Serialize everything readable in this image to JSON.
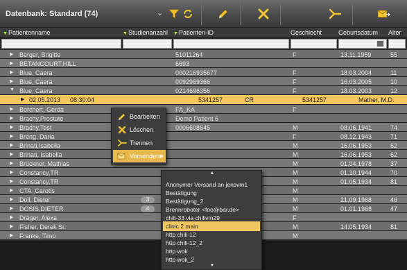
{
  "toolbar": {
    "title": "Datenbank: Standard (74)",
    "caret": "⌄",
    "icons": [
      "filter-icon",
      "refresh-icon",
      "edit-icon",
      "delete-icon",
      "split-icon",
      "send-icon"
    ]
  },
  "columns": [
    {
      "label": "Patientenname",
      "filter": true
    },
    {
      "label": "Studienanzahl",
      "filter": true
    },
    {
      "label": "Patienten-ID",
      "filter": true
    },
    {
      "label": "Geschlecht",
      "filter": false
    },
    {
      "label": "Geburtsdatum",
      "filter": false
    },
    {
      "label": "Alter",
      "filter": false
    }
  ],
  "rows": [
    {
      "name": "Berger, Brigitte",
      "count": "",
      "id": "51011264",
      "sex": "F",
      "dob": "13.11.1959",
      "age": "55",
      "exp": "▶"
    },
    {
      "name": "BETANCOURT,HILL",
      "count": "",
      "id": "6693",
      "sex": "",
      "dob": "",
      "age": "",
      "exp": "▶"
    },
    {
      "name": "Blue, Caera",
      "count": "",
      "id": "000216935677",
      "sex": "F",
      "dob": "18.03.2004",
      "age": "11",
      "exp": "▶"
    },
    {
      "name": "Blue, Caera",
      "count": "",
      "id": "0092969366",
      "sex": "F",
      "dob": "16.03.2005",
      "age": "10",
      "exp": "▶"
    },
    {
      "name": "Blue, Caera",
      "count": "",
      "id": "0214696356",
      "sex": "F",
      "dob": "18.03.2003",
      "age": "12",
      "exp": "▼"
    },
    {
      "name": "Borchert, Gerda",
      "count": "",
      "id": "FA_KA",
      "sex": "F",
      "dob": "",
      "age": "",
      "exp": "▶"
    },
    {
      "name": "Brachy,Prostate",
      "count": "",
      "id": "Demo Patient 6",
      "sex": "",
      "dob": "",
      "age": "",
      "exp": "▶"
    },
    {
      "name": "Brachy,Test",
      "count": "",
      "id": "0006608645",
      "sex": "M",
      "dob": "08.06.1941",
      "age": "74",
      "exp": "▶"
    },
    {
      "name": "Breng, Daria",
      "count": "",
      "id": "",
      "sex": "F",
      "dob": "08.12.1943",
      "age": "71",
      "exp": "▶"
    },
    {
      "name": "Brinati,Isabella",
      "count": "",
      "id": "",
      "sex": "M",
      "dob": "16.06.1953",
      "age": "62",
      "exp": "▶"
    },
    {
      "name": "Brinati, Isabella",
      "count": "",
      "id": "",
      "sex": "M",
      "dob": "16.06.1953",
      "age": "62",
      "exp": "▶"
    },
    {
      "name": "Brückner, Mathias",
      "count": "",
      "id": "",
      "sex": "M",
      "dob": "01.04.1978",
      "age": "37",
      "exp": "▶"
    },
    {
      "name": "Constancy,TR",
      "count": "",
      "id": "",
      "sex": "M",
      "dob": "01.10.1944",
      "age": "70",
      "exp": "▶"
    },
    {
      "name": "Constancy,TR",
      "count": "",
      "id": "",
      "sex": "M",
      "dob": "01.05.1934",
      "age": "81",
      "exp": "▶"
    },
    {
      "name": "CTA_Carotis",
      "count": "",
      "id": "",
      "sex": "M",
      "dob": "",
      "age": "",
      "exp": "▶"
    },
    {
      "name": "Doll, Dieter",
      "count": "3",
      "id": "",
      "sex": "M",
      "dob": "21.09.1968",
      "age": "46",
      "exp": "▶"
    },
    {
      "name": "DOSIS,DIETER",
      "count": "4",
      "id": "",
      "sex": "M",
      "dob": "01.01.1968",
      "age": "47",
      "exp": "▶"
    },
    {
      "name": "Dräger, Alexa",
      "count": "",
      "id": "",
      "sex": "F",
      "dob": "",
      "age": "",
      "exp": "▶"
    },
    {
      "name": "Fisher, Derek Sr.",
      "count": "",
      "id": "",
      "sex": "M",
      "dob": "14.05.1934",
      "age": "81",
      "exp": "▶"
    },
    {
      "name": "Franke, Timo",
      "count": "",
      "id": "",
      "sex": "M",
      "dob": "",
      "age": "",
      "exp": "▶"
    }
  ],
  "study_row": {
    "date": "02.05.2013",
    "time": "08:30:04",
    "id": "5341257",
    "modality": "CR",
    "accession": "5341257",
    "physician": "Mather, M.D."
  },
  "context_menu": [
    {
      "label": "Bearbeiten",
      "icon": "pencil-icon"
    },
    {
      "label": "Löschen",
      "icon": "delete-x-icon"
    },
    {
      "label": "Trennen",
      "icon": "split-icon"
    },
    {
      "label": "Versenden",
      "icon": "send-icon",
      "submenu": true
    }
  ],
  "send_targets": [
    "Anonymer Versand an jensvm1",
    "Bestätigung",
    "Bestätigung_2",
    "Brennroboter <foo@bar.de>",
    "chili-33 via chilivm29",
    "clinic 2 main",
    "http chili-12",
    "http chili-12_2",
    "http wok",
    "http wok_2"
  ],
  "highlighted_target": "clinic 2 main",
  "colors": {
    "accent": "#f3c760",
    "filter_icon": "#f5c530",
    "row_dark": "#6e6e6e",
    "row_light": "#777777"
  }
}
